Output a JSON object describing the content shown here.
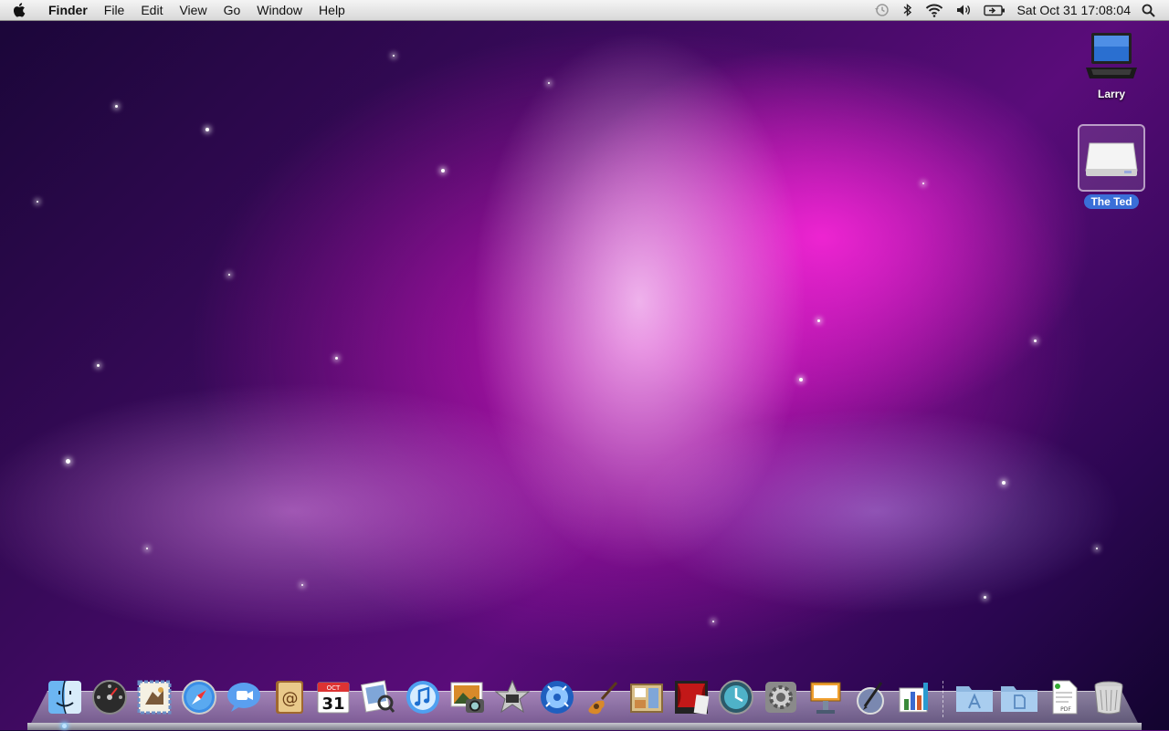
{
  "menubar": {
    "apple_icon": "apple-logo-icon",
    "app_name": "Finder",
    "items": [
      "File",
      "Edit",
      "View",
      "Go",
      "Window",
      "Help"
    ],
    "status_icons": [
      "time-machine-icon",
      "bluetooth-icon",
      "wifi-icon",
      "volume-icon",
      "battery-icon"
    ],
    "clock": "Sat Oct 31  17:08:04",
    "spotlight_icon": "spotlight-search-icon"
  },
  "desktop": {
    "icons": [
      {
        "label": "Larry",
        "icon": "laptop-icon",
        "selected": false
      },
      {
        "label": "The Ted",
        "icon": "external-drive-icon",
        "selected": true
      }
    ]
  },
  "dock": {
    "calendar_month": "OCT",
    "calendar_day": "31",
    "apps": [
      {
        "name": "finder",
        "glyph": "☺"
      },
      {
        "name": "dashboard",
        "glyph": "◉"
      },
      {
        "name": "mail",
        "glyph": "✉"
      },
      {
        "name": "safari",
        "glyph": "◎"
      },
      {
        "name": "ichat",
        "glyph": "💬"
      },
      {
        "name": "address-book",
        "glyph": "@"
      },
      {
        "name": "ical",
        "glyph": "31"
      },
      {
        "name": "preview",
        "glyph": "🔍"
      },
      {
        "name": "itunes",
        "glyph": "♫"
      },
      {
        "name": "iphoto",
        "glyph": "📷"
      },
      {
        "name": "imovie",
        "glyph": "★"
      },
      {
        "name": "idvd",
        "glyph": "◍"
      },
      {
        "name": "garageband",
        "glyph": "🎸"
      },
      {
        "name": "iweb",
        "glyph": "▤"
      },
      {
        "name": "front-row",
        "glyph": "▥"
      },
      {
        "name": "time-machine",
        "glyph": "⟳"
      },
      {
        "name": "system-preferences",
        "glyph": "⚙"
      },
      {
        "name": "keynote",
        "glyph": "▬"
      },
      {
        "name": "pages",
        "glyph": "✎"
      },
      {
        "name": "numbers",
        "glyph": "▮"
      }
    ],
    "stacks": [
      {
        "name": "applications-folder",
        "glyph": "A"
      },
      {
        "name": "documents-folder",
        "glyph": "▯"
      },
      {
        "name": "pdf-document",
        "glyph": "PDF"
      },
      {
        "name": "trash",
        "glyph": "🗑"
      }
    ]
  }
}
